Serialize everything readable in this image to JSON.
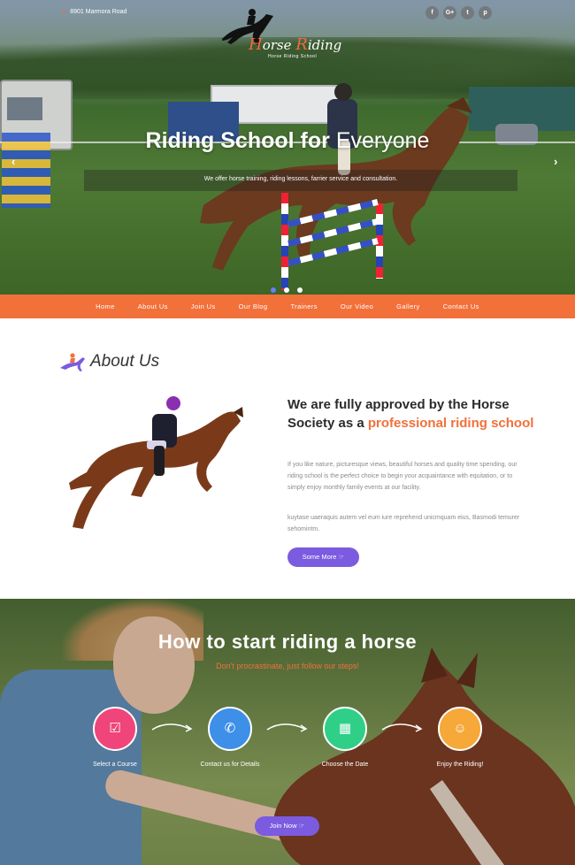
{
  "topbar": {
    "address_icon": "map-pin-icon",
    "address": "8901 Marmora Road",
    "logo_text_1": "H",
    "logo_text_2": "orse ",
    "logo_text_3": "R",
    "logo_text_4": "iding",
    "logo_tagline": "Horse Riding School",
    "socials": [
      {
        "icon": "facebook-icon",
        "glyph": "f"
      },
      {
        "icon": "google-plus-icon",
        "glyph": "G+"
      },
      {
        "icon": "twitter-icon",
        "glyph": "t"
      },
      {
        "icon": "pinterest-icon",
        "glyph": "p"
      }
    ]
  },
  "hero": {
    "title_bold": "Riding School for",
    "title_light": "Everyone",
    "subtitle": "We offer horse training, riding lessons, farrier service and consultation.",
    "prev_glyph": "‹",
    "next_glyph": "›",
    "slides": 3,
    "active_slide": 1
  },
  "nav": {
    "items": [
      "Home",
      "About Us",
      "Join Us",
      "Our Blog",
      "Trainers",
      "Our Video",
      "Gallery",
      "Contact Us"
    ]
  },
  "about": {
    "title": "About Us",
    "heading_1": "We are fully approved by the Horse Society as a ",
    "heading_highlight": "professional riding school",
    "paragraph_1": "If you like nature, picturesque views, beautiful horses and quality time spending, our riding school is the perfect choice to begin your acquaintance with equitation, or to simply enjoy monthly family events at our facility.",
    "paragraph_2": "kuytase uaeraquis autem vel eum iure reprehend unicmquam eius, Basmodi temurer sehomintm.",
    "button": "Some More ☞"
  },
  "steps": {
    "title": "How to start riding a horse",
    "subtitle": "Don't procrastinate, just follow our steps!",
    "items": [
      {
        "label": "Select a Course",
        "icon": "checkbox-icon",
        "glyph": "☑",
        "color": "#f0457a"
      },
      {
        "label": "Contact us for Details",
        "icon": "phone-icon",
        "glyph": "✆",
        "color": "#3d8fe8"
      },
      {
        "label": "Choose the Date",
        "icon": "calendar-icon",
        "glyph": "▦",
        "color": "#2fcf87"
      },
      {
        "label": "Enjoy the Riding!",
        "icon": "smile-icon",
        "glyph": "☺",
        "color": "#f6a838"
      }
    ],
    "button": "Join Now ☞"
  },
  "colors": {
    "accent": "#f2703a",
    "button": "#7b5be0"
  }
}
